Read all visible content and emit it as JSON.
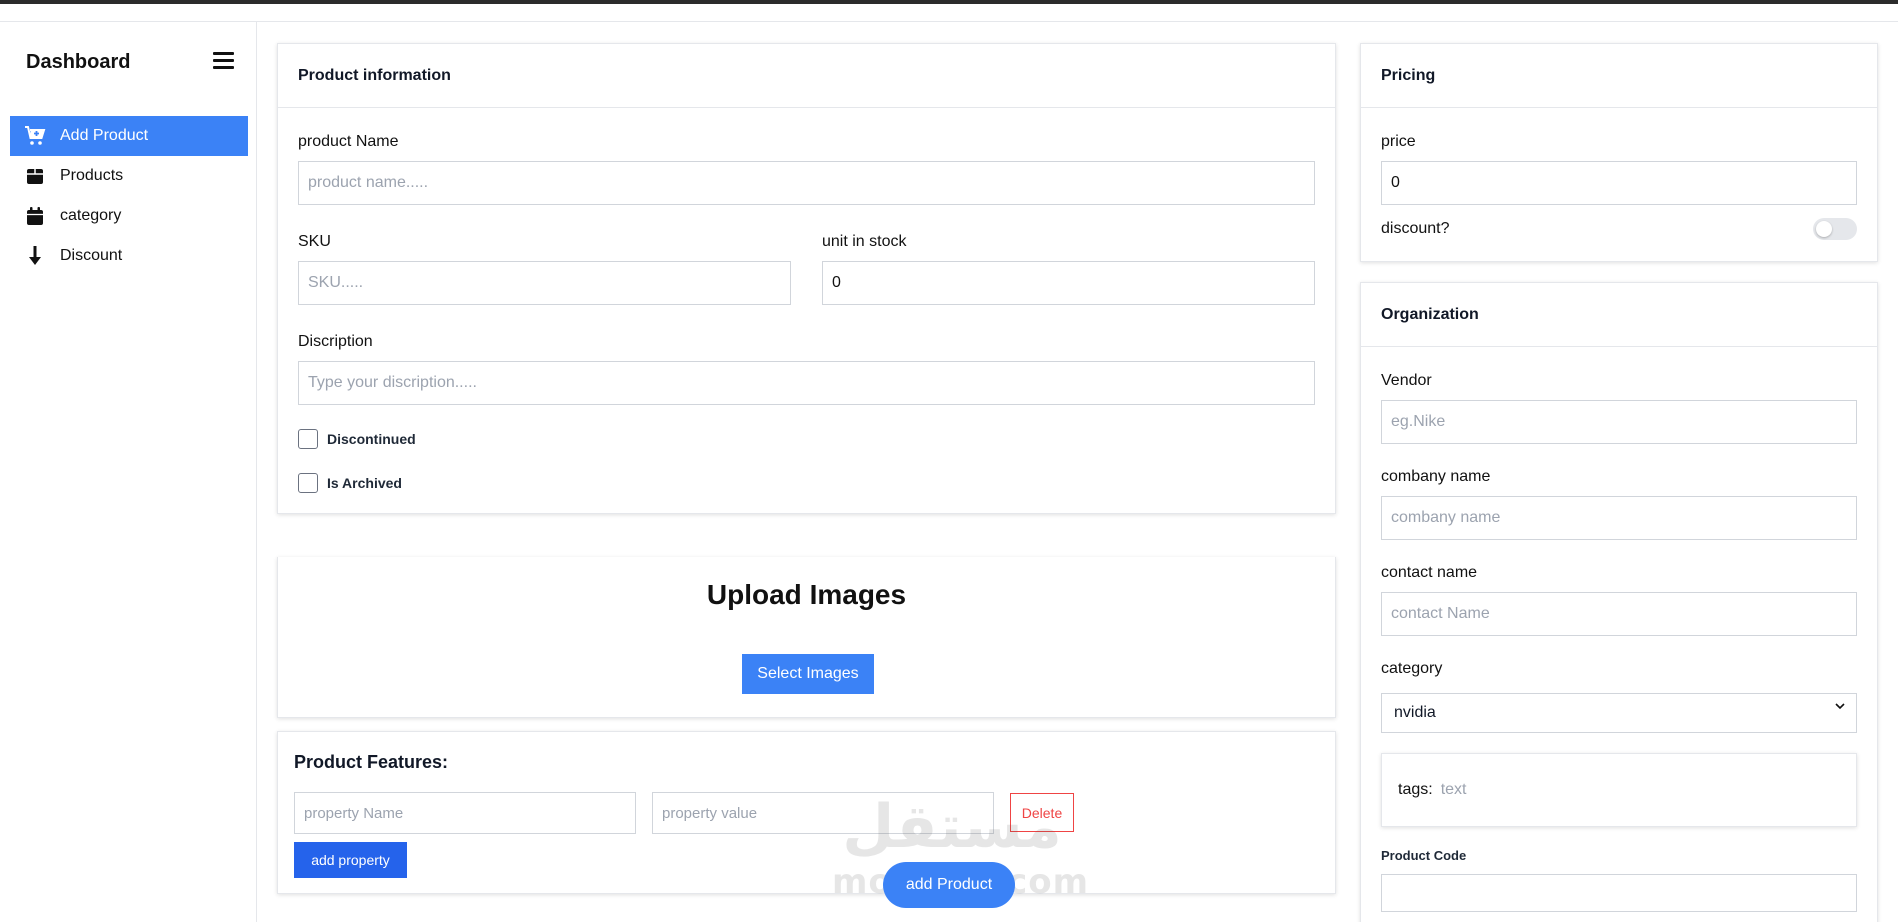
{
  "sidebar": {
    "title": "Dashboard",
    "items": [
      {
        "label": "Add Product",
        "icon": "cart-plus-icon",
        "active": true
      },
      {
        "label": "Products",
        "icon": "box-icon",
        "active": false
      },
      {
        "label": "category",
        "icon": "calendar-icon",
        "active": false
      },
      {
        "label": "Discount",
        "icon": "arrow-down-icon",
        "active": false
      }
    ]
  },
  "product_info": {
    "title": "Product information",
    "name_label": "product Name",
    "name_placeholder": "product name.....",
    "sku_label": "SKU",
    "sku_placeholder": "SKU.....",
    "stock_label": "unit in stock",
    "stock_value": "0",
    "desc_label": "Discription",
    "desc_placeholder": "Type your discription.....",
    "discontinued_label": "Discontinued",
    "archived_label": "Is Archived"
  },
  "upload": {
    "title": "Upload Images",
    "button": "Select Images"
  },
  "features": {
    "title": "Product Features:",
    "prop_name_placeholder": "property Name",
    "prop_value_placeholder": "property value",
    "delete_label": "Delete",
    "add_label": "add property"
  },
  "pricing": {
    "title": "Pricing",
    "price_label": "price",
    "price_value": "0",
    "discount_label": "discount?",
    "discount_enabled": false
  },
  "organization": {
    "title": "Organization",
    "vendor_label": "Vendor",
    "vendor_placeholder": "eg.Nike",
    "company_label": "combany name",
    "company_placeholder": "combany name",
    "contact_label": "contact name",
    "contact_placeholder": "contact Name",
    "category_label": "category",
    "category_value": "nvidia",
    "tags_label": "tags:",
    "tags_placeholder": "text",
    "code_label": "Product Code"
  },
  "add_product_button": "add Product",
  "watermark": {
    "arabic": "مستقل",
    "latin": "mostaql.com"
  },
  "colors": {
    "primary": "#3b82f6",
    "primary_dark": "#2563eb",
    "danger": "#ef4444"
  }
}
